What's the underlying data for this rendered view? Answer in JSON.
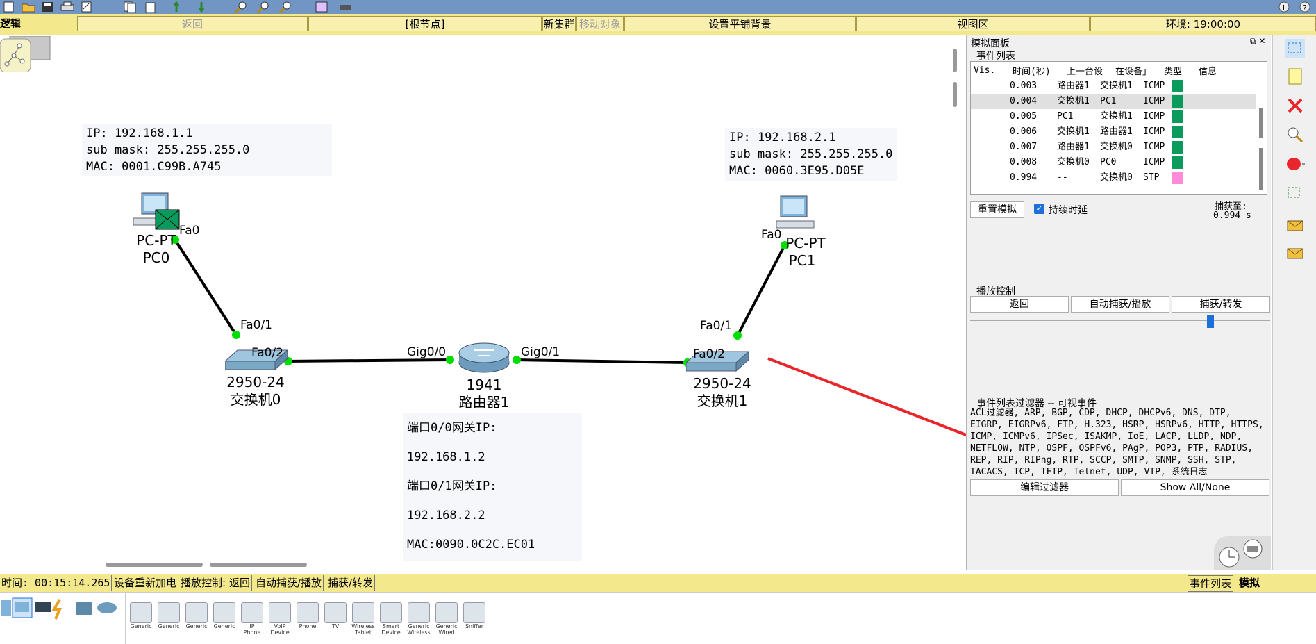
{
  "location_bar": {
    "back": "返回",
    "root": "[根节点]",
    "new_cluster": "新集群",
    "move_object": "移动对象",
    "set_tiled_background": "设置平铺背景",
    "viewport": "视图区",
    "environment": "环境: 19:00:00"
  },
  "mode_tab": "逻辑",
  "devices": {
    "pc0": {
      "model": "PC-PT",
      "name": "PC0",
      "port": "Fa0"
    },
    "pc1": {
      "model": "PC-PT",
      "name": "PC1",
      "port": "Fa0"
    },
    "switch0": {
      "model": "2950-24",
      "name": "交换机0",
      "port_up": "Fa0/1",
      "port_right": "Fa0/2"
    },
    "switch1": {
      "model": "2950-24",
      "name": "交换机1",
      "port_up": "Fa0/1",
      "port_left": "Fa0/2"
    },
    "router1": {
      "model": "1941",
      "name": "路由器1",
      "port_left": "Gig0/0",
      "port_right": "Gig0/1"
    }
  },
  "notes": {
    "pc0": [
      "IP: 192.168.1.1",
      "sub mask: 255.255.255.0",
      "MAC: 0001.C99B.A745"
    ],
    "pc1": [
      "IP: 192.168.2.1",
      "sub mask: 255.255.255.0",
      "MAC: 0060.3E95.D05E"
    ],
    "router": [
      "端口0/0网关IP: 192.168.1.2",
      "端口0/1网关IP: 192.168.2.2",
      "MAC:0090.0C2C.EC01"
    ]
  },
  "sim_panel": {
    "title": "模拟面板",
    "event_list_title": "事件列表",
    "columns": [
      "Vis.",
      "时间(秒)",
      "上一台设",
      "在设备」",
      "类型",
      "信息"
    ],
    "events": [
      {
        "time": "0.003",
        "last": "路由器1",
        "at": "交换机1",
        "type": "ICMP",
        "color": "#0a9a5c"
      },
      {
        "time": "0.004",
        "last": "交换机1",
        "at": "PC1",
        "type": "ICMP",
        "color": "#0a9a5c"
      },
      {
        "time": "0.005",
        "last": "PC1",
        "at": "交换机1",
        "type": "ICMP",
        "color": "#0a9a5c"
      },
      {
        "time": "0.006",
        "last": "交换机1",
        "at": "路由器1",
        "type": "ICMP",
        "color": "#0a9a5c"
      },
      {
        "time": "0.007",
        "last": "路由器1",
        "at": "交换机0",
        "type": "ICMP",
        "color": "#0a9a5c"
      },
      {
        "time": "0.008",
        "last": "交换机0",
        "at": "PC0",
        "type": "ICMP",
        "color": "#0a9a5c"
      },
      {
        "time": "0.994",
        "last": "--",
        "at": "交换机0",
        "type": "STP",
        "color": "#ff8ad8"
      }
    ],
    "reset_button": "重置模拟",
    "constant_delay": "持续时延",
    "captured_to": "捕获至:",
    "captured_value": "0.994 s",
    "play_controls_title": "播放控制",
    "play_back": "返回",
    "auto_capture": "自动捕获/播放",
    "capture_forward": "捕获/转发",
    "speed_slider_level": 0.8,
    "filter_title": "事件列表过滤器 -- 可视事件",
    "filter_text": "ACL过滤器, ARP, BGP, CDP, DHCP, DHCPv6, DNS, DTP, EIGRP, EIGRPv6, FTP, H.323, HSRP, HSRPv6, HTTP, HTTPS, ICMP, ICMPv6, IPSec, ISAKMP, IoE, LACP, LLDP, NDP, NETFLOW, NTP, OSPF, OSPFv6, PAgP, POP3, PTP, RADIUS, REP, RIP, RIPng, RTP, SCCP, SMTP, SNMP, SSH, STP, TACACS, TCP, TFTP, Telnet, UDP, VTP, 系统日志",
    "edit_filter": "编辑过滤器",
    "show_all": "Show All/None"
  },
  "bottom_bar": {
    "time": "时间: 00:15:14.265",
    "power_cycle": "设备重新加电",
    "play_control_label": "播放控制:",
    "back": "返回",
    "auto": "自动捕获/播放",
    "forward": "捕获/转发",
    "event_list": "事件列表",
    "simulation": "模拟"
  },
  "device_types": [
    "Generic",
    "Generic",
    "Generic",
    "Generic",
    "IP Phone",
    "VoIP Device",
    "Phone",
    "TV",
    "Wireless Tablet",
    "Smart Device",
    "Generic Wireless",
    "Generic Wired",
    "Sniffer"
  ],
  "colors": {
    "accent_bar": "#f4e88d",
    "toolbar": "#7196c4",
    "link": "#000000",
    "port_dot": "#00dd00",
    "arrow": "#e8262b"
  }
}
